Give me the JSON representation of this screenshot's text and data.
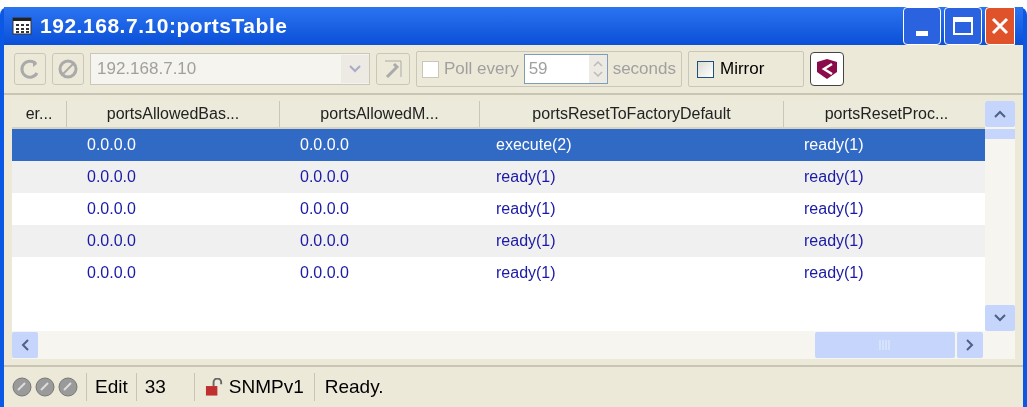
{
  "window": {
    "title": "192.168.7.10:portsTable"
  },
  "toolbar": {
    "address": {
      "value": "192.168.7.10",
      "disabled": true
    },
    "poll": {
      "label": "Poll every",
      "checked": false,
      "disabled": true,
      "interval": "59",
      "unit": "seconds"
    },
    "mirror": {
      "label": "Mirror",
      "checked": false
    }
  },
  "table": {
    "columns": [
      "er...",
      "portsAllowedBas...",
      "portsAllowedM...",
      "portsResetToFactoryDefault",
      "portsResetProc..."
    ],
    "rows": [
      {
        "selected": true,
        "cells": [
          "",
          "0.0.0.0",
          "0.0.0.0",
          "execute(2)",
          "ready(1)"
        ]
      },
      {
        "selected": false,
        "cells": [
          "",
          "0.0.0.0",
          "0.0.0.0",
          "ready(1)",
          "ready(1)"
        ]
      },
      {
        "selected": false,
        "cells": [
          "",
          "0.0.0.0",
          "0.0.0.0",
          "ready(1)",
          "ready(1)"
        ]
      },
      {
        "selected": false,
        "cells": [
          "",
          "0.0.0.0",
          "0.0.0.0",
          "ready(1)",
          "ready(1)"
        ]
      },
      {
        "selected": false,
        "cells": [
          "",
          "0.0.0.0",
          "0.0.0.0",
          "ready(1)",
          "ready(1)"
        ]
      }
    ]
  },
  "status_bar": {
    "mode": "Edit",
    "count": "33",
    "protocol": "SNMPv1",
    "message": "Ready."
  }
}
